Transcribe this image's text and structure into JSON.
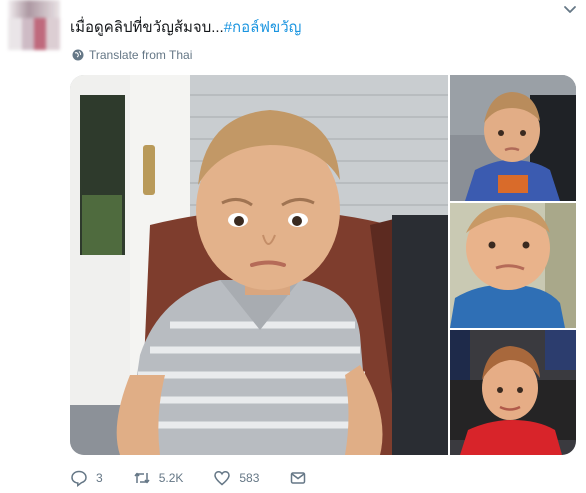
{
  "tweet": {
    "text_main": "เมื่อดูคลิปที่ขวัญส้มจบ...",
    "hashtag": "#กอล์ฟขวัญ",
    "translate_label": "Translate from Thai"
  },
  "media": {
    "photos": [
      "main-photo",
      "thumb-photo-1",
      "thumb-photo-2",
      "thumb-photo-3"
    ]
  },
  "actions": {
    "reply_count": "3",
    "retweet_count": "5.2K",
    "like_count": "583"
  },
  "colors": {
    "accent": "#1b95e0",
    "secondary_text": "#657786"
  },
  "icons": [
    "chevron-down-icon",
    "globe-icon",
    "reply-icon",
    "retweet-icon",
    "like-icon",
    "message-icon"
  ]
}
